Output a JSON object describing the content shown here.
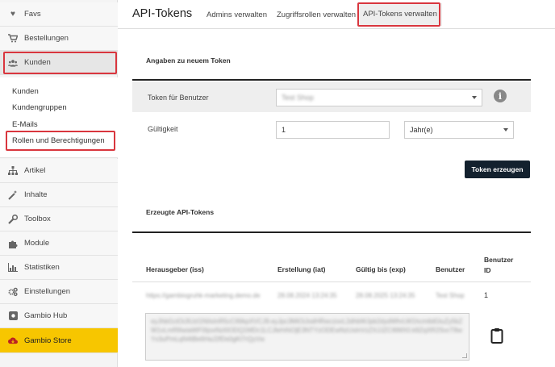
{
  "sidebar": {
    "items_top": [
      {
        "label": "Favs",
        "icon": "heart-icon"
      },
      {
        "label": "Bestellungen",
        "icon": "cart-icon"
      },
      {
        "label": "Kunden",
        "icon": "users-icon"
      }
    ],
    "sub_items": [
      "Kunden",
      "Kundengruppen",
      "E-Mails",
      "Rollen und Berechtigungen"
    ],
    "items_bottom": [
      {
        "label": "Artikel",
        "icon": "sitemap-icon"
      },
      {
        "label": "Inhalte",
        "icon": "magic-icon"
      },
      {
        "label": "Toolbox",
        "icon": "wrench-icon"
      },
      {
        "label": "Module",
        "icon": "puzzle-icon"
      },
      {
        "label": "Statistiken",
        "icon": "chart-icon"
      },
      {
        "label": "Einstellungen",
        "icon": "gears-icon"
      },
      {
        "label": "Gambio Hub",
        "icon": "hub-icon"
      },
      {
        "label": "Gambio Store",
        "icon": "cloud-download-icon"
      }
    ]
  },
  "header": {
    "title": "API-Tokens",
    "tabs": [
      "Admins verwalten",
      "Zugriffsrollen verwalten",
      "API-Tokens verwalten"
    ]
  },
  "form": {
    "section_title": "Angaben zu neuem Token",
    "user_label": "Token für Benutzer",
    "user_value": "Test Shop",
    "validity_label": "Gültigkeit",
    "validity_value": "1",
    "unit_value": "Jahr(e)",
    "submit_label": "Token erzeugen"
  },
  "tokens": {
    "section_title": "Erzeugte API-Tokens",
    "columns": [
      "Herausgeber (iss)",
      "Erstellung (iat)",
      "Gültig bis (exp)",
      "Benutzer",
      "Benutzer ID"
    ],
    "rows": [
      {
        "issuer": "https://gambiogruhk-marketing.demo.de",
        "created": "28.08.2024 13:24:35",
        "valid_until": "28.08.2025 13:24:35",
        "user": "Test Shop",
        "user_id": "1",
        "token": "eyJhbGciOiJIUzI1NiIsInR5cCI6IkpXVCJ9.eyJpc3MiOiJodHRwczovL2dhbWJpb2dydWhrLW1hcmtldGluZy5kZW1vLmRlIiwiaWF0IjoxNzI0ODQ1MDc1LCJleHAiOjE3NTYzODEwNzUsInVzZXJJZCI6MX0.k9ZqXR2SvcT8wYx3uPmLqN4tBe6HaJ2fDs0gKl7rQyVw"
      }
    ]
  }
}
